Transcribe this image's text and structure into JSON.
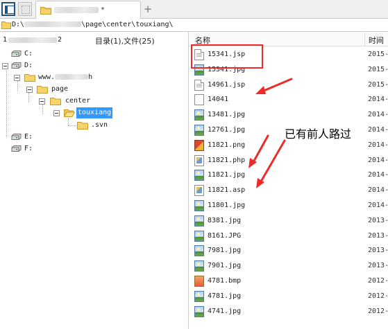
{
  "tabs": {
    "active_label": "*"
  },
  "address": {
    "path_prefix": "D:\\",
    "path_suffix": "\\page\\center\\touxiang\\"
  },
  "left_header": {
    "partial": "1",
    "partial_tail": "2",
    "summary": "目录(1),文件(25)"
  },
  "right_header": {
    "name": "名称",
    "time": "时间"
  },
  "tree": {
    "drive_c": "C:",
    "drive_d": "D:",
    "www": "www.",
    "www_tail": "h",
    "page": "page",
    "center": "center",
    "touxiang": "touxiang",
    "svn": ".svn",
    "drive_e": "E:",
    "drive_f": "F:"
  },
  "files": [
    {
      "name": "15341.jsp",
      "date": "2015-",
      "icon": "doc-icon"
    },
    {
      "name": "15341.jpg",
      "date": "2015-",
      "icon": "image-icon"
    },
    {
      "name": "14961.jsp",
      "date": "2015-",
      "icon": "doc-icon"
    },
    {
      "name": "14041",
      "date": "2014-",
      "icon": "blank-file-icon"
    },
    {
      "name": "13481.jpg",
      "date": "2014-",
      "icon": "image-icon"
    },
    {
      "name": "12761.jpg",
      "date": "2014-",
      "icon": "image-icon"
    },
    {
      "name": "11821.png",
      "date": "2014-",
      "icon": "png-icon"
    },
    {
      "name": "11821.php",
      "date": "2014-",
      "icon": "php-icon"
    },
    {
      "name": "11821.jpg",
      "date": "2014-",
      "icon": "image-icon"
    },
    {
      "name": "11821.asp",
      "date": "2014-",
      "icon": "php-icon"
    },
    {
      "name": "11801.jpg",
      "date": "2014-",
      "icon": "image-icon"
    },
    {
      "name": "8381.jpg",
      "date": "2013-",
      "icon": "image-icon"
    },
    {
      "name": "8161.JPG",
      "date": "2013-",
      "icon": "image-icon"
    },
    {
      "name": "7981.jpg",
      "date": "2013-",
      "icon": "image-icon"
    },
    {
      "name": "7901.jpg",
      "date": "2013-",
      "icon": "image-icon"
    },
    {
      "name": "4781.bmp",
      "date": "2012-",
      "icon": "bmp-icon"
    },
    {
      "name": "4781.jpg",
      "date": "2012-",
      "icon": "image-icon"
    },
    {
      "name": "4741.jpg",
      "date": "2012-",
      "icon": "image-icon"
    }
  ],
  "annotation": {
    "note": "已有前人路过",
    "color": "#ee2a2a"
  }
}
